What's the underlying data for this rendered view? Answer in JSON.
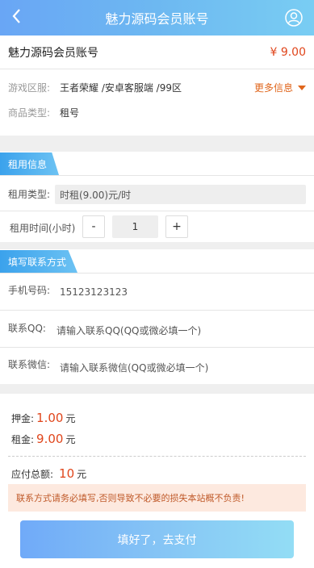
{
  "header": {
    "title": "魅力源码会员账号"
  },
  "product": {
    "name": "魅力源码会员账号",
    "price": "¥ 9.00"
  },
  "info": {
    "server_label": "游戏区服:",
    "server_value": "王者荣耀 /安卓客服端 /99区",
    "more_label": "更多信息",
    "type_label": "商品类型:",
    "type_value": "租号"
  },
  "rent": {
    "section_title": "租用信息",
    "type_label": "租用类型:",
    "type_value": "时租(9.00)元/时",
    "time_label": "租用时间(小时)",
    "minus": "-",
    "quantity": "1",
    "plus": "+"
  },
  "contact": {
    "section_title": "填写联系方式",
    "phone_label": "手机号码:",
    "phone_value": "15123123123",
    "qq_label": "联系QQ:",
    "qq_placeholder": "请输入联系QQ(QQ或微必填一个)",
    "wechat_label": "联系微信:",
    "wechat_placeholder": "请输入联系微信(QQ或微必填一个)"
  },
  "fees": {
    "deposit_label": "押金:",
    "deposit_value": "1.00",
    "rent_label": "租金:",
    "rent_value": "9.00",
    "total_label": "应付总额:",
    "total_value": "10",
    "unit": "元"
  },
  "notice": "联系方式请务必填写,否则导致不必要的损失本站概不负责!",
  "pay_button": "填好了，去支付",
  "colors": {
    "accent": "#e0461c",
    "header_start": "#69a6f5",
    "header_end": "#79cdf3"
  }
}
